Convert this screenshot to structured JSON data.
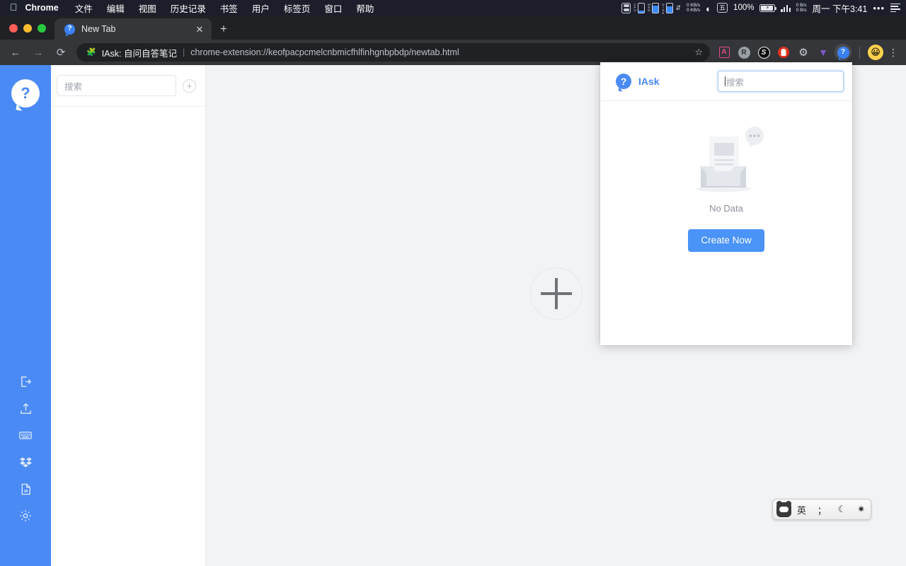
{
  "menubar": {
    "apple_icon": "apple-logo-icon",
    "app_name": "Chrome",
    "items": [
      "文件",
      "编辑",
      "视图",
      "历史记录",
      "书签",
      "用户",
      "标签页",
      "窗口",
      "帮助"
    ],
    "status": {
      "cpu_label": "CPU",
      "mem_label": "MEM",
      "disk_label": "DISK",
      "net_speed_up": "0 KB/s",
      "net_speed_down": "0 KB/s",
      "wifi_icon": "wifi-icon",
      "kbd_layout": "五",
      "battery_percent": "100%",
      "battery_icon": "battery-charging-icon",
      "signal_icon": "signal-bars-icon",
      "traffic_up": "0 B/s",
      "traffic_down": "0 B/s",
      "clock": "周一 下午3:41",
      "dots_icon": "ellipsis-icon",
      "control_center_icon": "control-center-icon"
    }
  },
  "window": {
    "traffic_lights": {
      "close_color": "#ff5f57",
      "minimize_color": "#febc2e",
      "maximize_color": "#28c840"
    },
    "tab": {
      "title": "New Tab",
      "favicon": "iask-question-bubble-icon",
      "close_label": "✕"
    },
    "new_tab_label": "+"
  },
  "toolbar": {
    "back_icon": "arrow-left-icon",
    "forward_icon": "arrow-right-icon",
    "reload_icon": "reload-icon",
    "back_glyph": "←",
    "forward_glyph": "→",
    "reload_glyph": "⟳",
    "omnibox": {
      "extension_icon": "puzzle-piece-icon",
      "extension_name": "IAsk: 自问自答笔记",
      "separator": "|",
      "url": "chrome-extension://keofpacpcmelcnbmicfhlfinhgnbpbdp/newtab.html",
      "bookmark_star": "☆"
    },
    "extensions": [
      {
        "name": "adobe-acrobat-extension",
        "glyph": "A"
      },
      {
        "name": "grammarly-extension",
        "glyph": "R"
      },
      {
        "name": "s-extension",
        "glyph": "S"
      },
      {
        "name": "adblock-extension",
        "glyph": ""
      },
      {
        "name": "settings-extension",
        "glyph": "⚙"
      },
      {
        "name": "v-extension",
        "glyph": "▼"
      },
      {
        "name": "iask-extension",
        "glyph": "?"
      }
    ],
    "avatar_emoji": "😀",
    "menu_icon": "kebab-menu-icon",
    "menu_glyph": "⋮"
  },
  "sidebar": {
    "logo_name": "iask-logo-icon",
    "logo_glyph": "?",
    "icons": [
      {
        "name": "export-icon",
        "label": "导出"
      },
      {
        "name": "upload-icon",
        "label": "上传"
      },
      {
        "name": "keyboard-shortcuts-icon",
        "label": "快捷键"
      },
      {
        "name": "dropbox-sync-icon",
        "label": "Dropbox"
      },
      {
        "name": "markdown-file-icon",
        "label": "Markdown"
      },
      {
        "name": "settings-gear-icon",
        "label": "设置"
      }
    ]
  },
  "notelist": {
    "search_placeholder": "搜索",
    "search_value": "",
    "add_button_glyph": "+"
  },
  "editor": {
    "empty_add_glyph": "+",
    "empty_add_name": "create-note-placeholder"
  },
  "popup": {
    "logo_name": "iask-popup-logo-icon",
    "logo_glyph": "?",
    "brand": "IAsk",
    "search_placeholder": "搜索",
    "search_value": "",
    "empty_state": {
      "illustration": "empty-inbox-illustration",
      "text": "No Data"
    },
    "create_button": "Create Now",
    "accent_color": "#4a93f7"
  },
  "ime": {
    "logo_name": "sogou-panda-icon",
    "mode": "英",
    "punctuation": "；",
    "moon_icon": "moon-icon",
    "moon_glyph": "☾",
    "settings_icon": "gear-icon",
    "settings_glyph": "✷"
  },
  "colors": {
    "brand_blue": "#4a8af4",
    "menubar_bg": "#1c1f2b",
    "chrome_toolbar": "#35363a",
    "page_bg": "#f2f3f5"
  }
}
